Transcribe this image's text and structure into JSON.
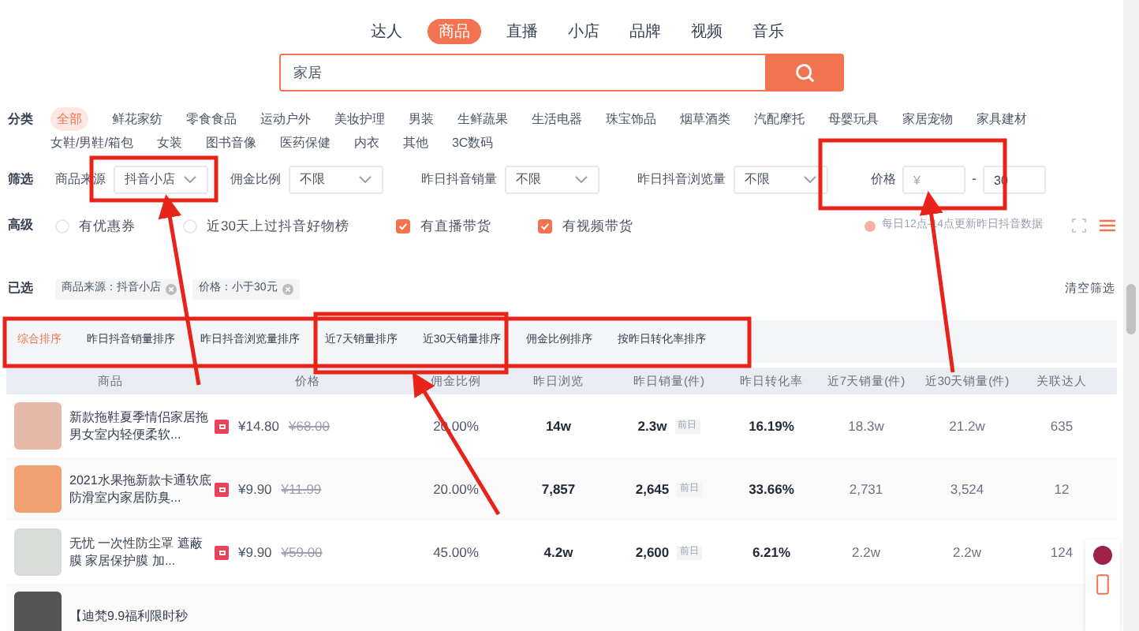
{
  "nav_tabs": [
    {
      "label": "达人",
      "selected": false
    },
    {
      "label": "商品",
      "selected": true
    },
    {
      "label": "直播",
      "selected": false
    },
    {
      "label": "小店",
      "selected": false
    },
    {
      "label": "品牌",
      "selected": false
    },
    {
      "label": "视频",
      "selected": false
    },
    {
      "label": "音乐",
      "selected": false
    }
  ],
  "search": {
    "value": "家居"
  },
  "categories": {
    "label": "分类",
    "items": [
      {
        "label": "全部",
        "selected": true
      },
      {
        "label": "鲜花家纺",
        "selected": false
      },
      {
        "label": "零食食品",
        "selected": false
      },
      {
        "label": "运动户外",
        "selected": false
      },
      {
        "label": "美妆护理",
        "selected": false
      },
      {
        "label": "男装",
        "selected": false
      },
      {
        "label": "生鲜蔬果",
        "selected": false
      },
      {
        "label": "生活电器",
        "selected": false
      },
      {
        "label": "珠宝饰品",
        "selected": false
      },
      {
        "label": "烟草酒类",
        "selected": false
      },
      {
        "label": "汽配摩托",
        "selected": false
      },
      {
        "label": "母婴玩具",
        "selected": false
      },
      {
        "label": "家居宠物",
        "selected": false
      },
      {
        "label": "家具建材",
        "selected": false
      },
      {
        "label": "女鞋/男鞋/箱包",
        "selected": false
      },
      {
        "label": "女装",
        "selected": false
      },
      {
        "label": "图书音像",
        "selected": false
      },
      {
        "label": "医药保健",
        "selected": false
      },
      {
        "label": "内衣",
        "selected": false
      },
      {
        "label": "其他",
        "selected": false
      },
      {
        "label": "3C数码",
        "selected": false
      }
    ]
  },
  "filters": {
    "label": "筛选",
    "selects": [
      {
        "label": "商品来源",
        "value": "抖音小店"
      },
      {
        "label": "佣金比例",
        "value": "不限"
      },
      {
        "label": "昨日抖音销量",
        "value": "不限"
      },
      {
        "label": "昨日抖音浏览量",
        "value": "不限"
      }
    ],
    "price": {
      "label": "价格",
      "min_placeholder": "¥",
      "separator": "-",
      "max_value": "30"
    }
  },
  "advanced": {
    "label": "高级",
    "options": [
      {
        "label": "有优惠券",
        "checked": false
      },
      {
        "label": "近30天上过抖音好物榜",
        "checked": false
      },
      {
        "label": "有直播带货",
        "checked": true
      },
      {
        "label": "有视频带货",
        "checked": true
      }
    ],
    "notice": "每日12点-14点更新昨日抖音数据"
  },
  "selected_filters": {
    "label": "已选",
    "tags": [
      "商品来源：抖音小店",
      "价格：小于30元"
    ],
    "clear": "清空筛选"
  },
  "sort_options": [
    {
      "label": "综合排序",
      "selected": true
    },
    {
      "label": "昨日抖音销量排序",
      "selected": false
    },
    {
      "label": "昨日抖音浏览量排序",
      "selected": false
    },
    {
      "label": "近7天销量排序",
      "selected": false
    },
    {
      "label": "近30天销量排序",
      "selected": false
    },
    {
      "label": "佣金比例排序",
      "selected": false
    },
    {
      "label": "按昨日转化率排序",
      "selected": false
    }
  ],
  "table": {
    "columns": [
      "商品",
      "价格",
      "佣金比例",
      "昨日浏览",
      "昨日销量(件)",
      "昨日转化率",
      "近7天销量(件)",
      "近30天销量(件)",
      "关联达人"
    ],
    "rows": [
      {
        "name": "新款拖鞋夏季情侣家居拖男女室内轻便柔软...",
        "price": "¥14.80",
        "old_price": "¥68.00",
        "commission": "20.00%",
        "views": "14w",
        "sales": "2.3w",
        "sales_tag": "前日",
        "conversion": "16.19%",
        "sales_7d": "18.3w",
        "sales_30d": "21.2w",
        "influencers": "635"
      },
      {
        "name": "2021水果拖新款卡通软底防滑室内家居防臭...",
        "price": "¥9.90",
        "old_price": "¥11.99",
        "commission": "20.00%",
        "views": "7,857",
        "sales": "2,645",
        "sales_tag": "前日",
        "conversion": "33.66%",
        "sales_7d": "2,731",
        "sales_30d": "3,524",
        "influencers": "12"
      },
      {
        "name": "无忧 一次性防尘罩 遮蔽膜 家居保护膜 加...",
        "price": "¥9.90",
        "old_price": "¥59.00",
        "commission": "45.00%",
        "views": "4.2w",
        "sales": "2,600",
        "sales_tag": "前日",
        "conversion": "6.21%",
        "sales_7d": "2.2w",
        "sales_30d": "2.2w",
        "influencers": "124"
      },
      {
        "name": "【迪梵9.9福利限时秒"
      }
    ]
  }
}
